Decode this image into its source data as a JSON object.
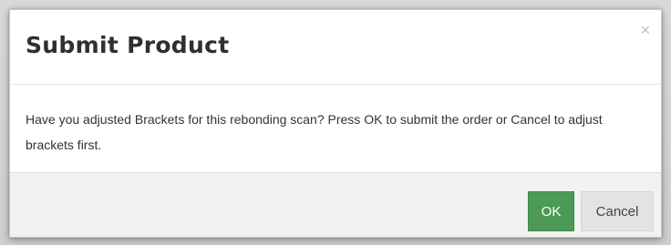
{
  "dialog": {
    "title": "Submit Product",
    "close_label": "×",
    "message": "Have you adjusted Brackets for this rebonding scan? Press OK to submit the order or Cancel to adjust brackets first.",
    "ok_label": "OK",
    "cancel_label": "Cancel"
  },
  "colors": {
    "ok_button": "#4c9a56",
    "cancel_button": "#e3e3e3",
    "footer_background": "#f2f2f2",
    "title_text": "#2f2f2f"
  },
  "icons": {
    "close": "close-icon"
  }
}
